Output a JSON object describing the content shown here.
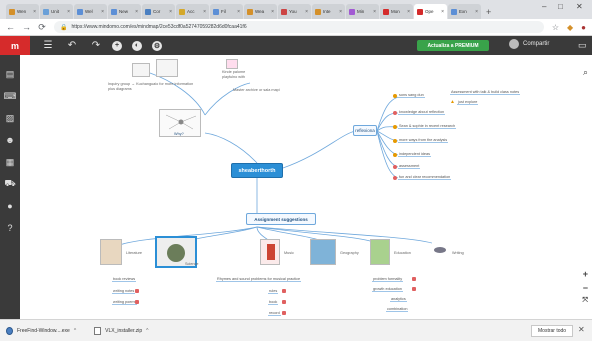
{
  "browser": {
    "tabs": [
      {
        "label": "Wen",
        "color": "#d4902a"
      },
      {
        "label": "Unit",
        "color": "#6aa0d8"
      },
      {
        "label": "Wel",
        "color": "#5c8fd6"
      },
      {
        "label": "New",
        "color": "#5c8fd6"
      },
      {
        "label": "Cor",
        "color": "#4a7fc1"
      },
      {
        "label": "Acc",
        "color": "#d4a82a"
      },
      {
        "label": "Fil",
        "color": "#5c8fd6"
      },
      {
        "label": "Wea",
        "color": "#d4902a"
      },
      {
        "label": "You",
        "color": "#c44"
      },
      {
        "label": "Inte",
        "color": "#d4902a"
      },
      {
        "label": "Min",
        "color": "#a25ad3"
      },
      {
        "label": "Mon",
        "color": "#d42b2b"
      },
      {
        "label": "Ope",
        "color": "#d42b2b",
        "active": true
      },
      {
        "label": "Exn",
        "color": "#5c8fd6"
      }
    ],
    "url": "https://www.mindomo.com/es/mindmap/2ce53cdf0a52747059282d6d0fcaa41f6",
    "back_icon": "back-arrow-icon",
    "forward_icon": "forward-arrow-icon",
    "reload_icon": "reload-icon"
  },
  "toolbar": {
    "logo": "m",
    "premium_label": "Actualiza a PREMIUM",
    "share_label": "Compartir",
    "icons": [
      "menu-icon",
      "undo-icon",
      "redo-icon",
      "add-topic-icon",
      "style-icon",
      "settings-icon"
    ]
  },
  "sidebar_icons": [
    "outline-icon",
    "keyboard-icon",
    "image-icon",
    "emoji-icon",
    "notes-icon",
    "people-icon",
    "bulb-icon",
    "help-icon"
  ],
  "map": {
    "central": "sheaberthorth",
    "why": "Why?",
    "top_note_1": "Inquiry group → Kuchanguaio for more information",
    "top_note_2": "plus diagrams",
    "top_note_3": "Kinde palome",
    "top_note_4": "playfulno with",
    "top_note_5": "Kuchanguaio and ... ",
    "top_note_6": "Master archive or sala mapi",
    "reflect": "reflexiona",
    "reflect_items": [
      "sons sang dun",
      "knowledge about reflection",
      "Sean & sophie in recent research",
      "more ways from the analysis",
      "independent ideas",
      "assessment",
      "fun and clear recommendation"
    ],
    "reflect_sub": "Assessment with talk & build class notes",
    "reflect_sub2": "just explore",
    "assignment": "Assignment suggestions",
    "assign_nodes": [
      "Literature",
      "Science",
      "Music",
      "Geography",
      "Education",
      "Writing"
    ],
    "lit_items": [
      "book reviews",
      "writing notes",
      "writing poems"
    ],
    "music_items": [
      "Rhymes and sound problems for musical practice",
      "rules",
      "book",
      "record"
    ],
    "edu_items": [
      "problem formality",
      "growth education",
      "analytics",
      "combination"
    ]
  },
  "zoom": {
    "in": "+",
    "out": "−",
    "fit": "⤧"
  },
  "downloads": {
    "items": [
      {
        "name": "FreeFind-Window....exe",
        "icon": "firefox-file-icon"
      },
      {
        "name": "VLX_installer.zip",
        "icon": "document-icon"
      }
    ],
    "show_all": "Mostrar todo",
    "close_icon": "close-icon"
  }
}
